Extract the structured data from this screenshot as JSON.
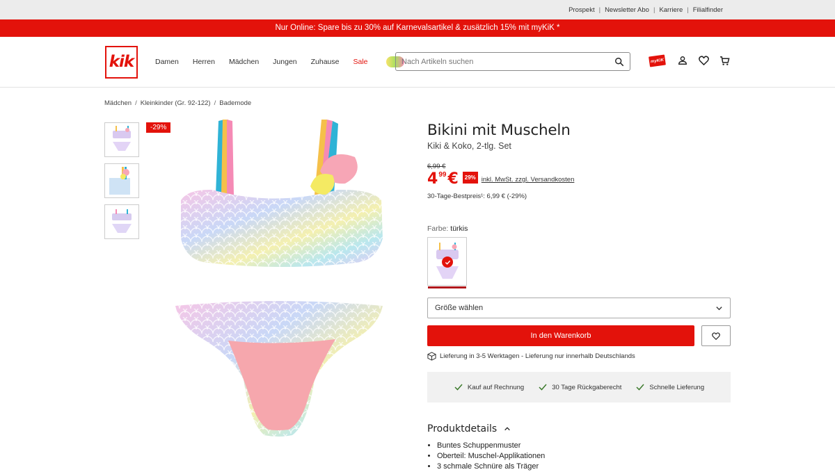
{
  "utility_links": [
    "Prospekt",
    "Newsletter Abo",
    "Karriere",
    "Filialfinder"
  ],
  "promo_text": "Nur Online: Spare bis zu 30% auf Karnevalsartikel & zusätzlich 15% mit myKiK *",
  "logo_text": "kik",
  "nav": [
    "Damen",
    "Herren",
    "Mädchen",
    "Jungen",
    "Zuhause",
    "Sale"
  ],
  "search": {
    "placeholder": "Nach Artikeln suchen"
  },
  "header_card_text": "myKiK",
  "breadcrumb": [
    "Mädchen",
    "Kleinkinder (Gr. 92-122)",
    "Bademode"
  ],
  "discount_badge": "-29%",
  "product": {
    "title": "Bikini mit Muscheln",
    "subtitle": "Kiki & Koko, 2-tlg. Set",
    "old_price": "6,99 €",
    "price_main": "4",
    "price_cents": "99",
    "price_currency": "€",
    "price_badge": "29%",
    "tax_note": "inkl. MwSt. zzgl. Versandkosten",
    "best_price": "30-Tage-Bestpreis¹: 6,99 € (-29%)",
    "color_label": "Farbe:",
    "color_value": "türkis",
    "size_placeholder": "Größe wählen",
    "cart_label": "In den Warenkorb",
    "delivery": "Lieferung in 3-5 Werktagen - Lieferung nur innerhalb Deutschlands"
  },
  "benefits": [
    "Kauf auf Rechnung",
    "30 Tage Rückgaberecht",
    "Schnelle Lieferung"
  ],
  "details": {
    "heading": "Produktdetails",
    "items": [
      "Buntes Schuppenmuster",
      "Oberteil: Muschel-Applikationen",
      "3 schmale Schnüre als Träger"
    ]
  },
  "colors": {
    "brand_red": "#e3120b",
    "dark_red": "#b0171b"
  }
}
